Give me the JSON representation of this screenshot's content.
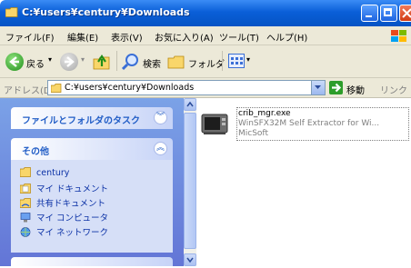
{
  "window": {
    "title": "C:¥users¥century¥Downloads"
  },
  "menubar": {
    "items": [
      "ファイル(F)",
      "編集(E)",
      "表示(V)",
      "お気に入り(A)",
      "ツール(T)",
      "ヘルプ(H)"
    ]
  },
  "toolbar": {
    "back_label": "戻る",
    "search_label": "検索",
    "folders_label": "フォルダ"
  },
  "address": {
    "label": "アドレス(D)",
    "value": "C:¥users¥century¥Downloads",
    "go_label": "移動",
    "links_label": "リンク »"
  },
  "tasks": {
    "folder_tasks_title": "ファイルとフォルダのタスク",
    "other_title": "その他",
    "other_places": [
      {
        "label": "century",
        "icon": "folder-icon"
      },
      {
        "label": "マイ ドキュメント",
        "icon": "documents-icon"
      },
      {
        "label": "共有ドキュメント",
        "icon": "shared-folder-icon"
      },
      {
        "label": "マイ コンピュータ",
        "icon": "computer-icon"
      },
      {
        "label": "マイ ネットワーク",
        "icon": "network-icon"
      }
    ]
  },
  "files": [
    {
      "name": "crib_mgr.exe",
      "description": "WinSFX32M Self Extractor for Wi...",
      "company": "MicSoft",
      "icon": "installer-icon"
    }
  ],
  "colors": {
    "titlebar": "#0a5fd8",
    "taskpane": "#7ba2e7",
    "link": "#215dc6"
  }
}
